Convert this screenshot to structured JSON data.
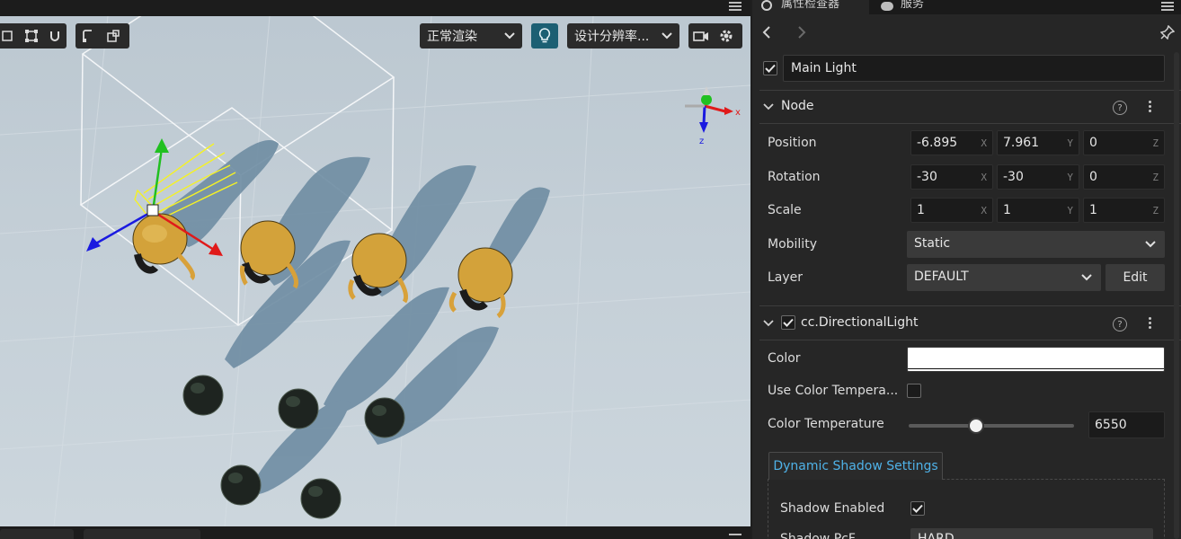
{
  "scene": {
    "render_mode": "正常渲染",
    "resolution": "设计分辨率...",
    "gizmo_axes": {
      "x": "x",
      "z": "z"
    },
    "bottom_tabs": [
      "",
      ""
    ]
  },
  "inspector": {
    "tabs": [
      "属性检查器",
      "服务"
    ],
    "node_active": true,
    "node_name": "Main Light",
    "node_section": {
      "title": "Node",
      "position": {
        "label": "Position",
        "x": "-6.895",
        "y": "7.961",
        "z": "0"
      },
      "rotation": {
        "label": "Rotation",
        "x": "-30",
        "y": "-30",
        "z": "0"
      },
      "scale": {
        "label": "Scale",
        "x": "1",
        "y": "1",
        "z": "1"
      },
      "mobility": {
        "label": "Mobility",
        "value": "Static"
      },
      "layer": {
        "label": "Layer",
        "value": "DEFAULT",
        "edit_label": "Edit"
      },
      "axis_labels": {
        "x": "X",
        "y": "Y",
        "z": "Z"
      }
    },
    "light_section": {
      "title": "cc.DirectionalLight",
      "enabled": true,
      "color": {
        "label": "Color",
        "value": "#ffffff"
      },
      "use_color_temperature": {
        "label": "Use Color Tempera...",
        "checked": false
      },
      "color_temperature": {
        "label": "Color Temperature",
        "value": "6550",
        "slider_fraction": 0.41
      },
      "shadow_tab": "Dynamic Shadow Settings",
      "shadow_enabled": {
        "label": "Shadow Enabled",
        "checked": true
      },
      "next_row_label": "Shadow PcF",
      "next_row_value": "HARD"
    },
    "help_glyph": "?"
  }
}
